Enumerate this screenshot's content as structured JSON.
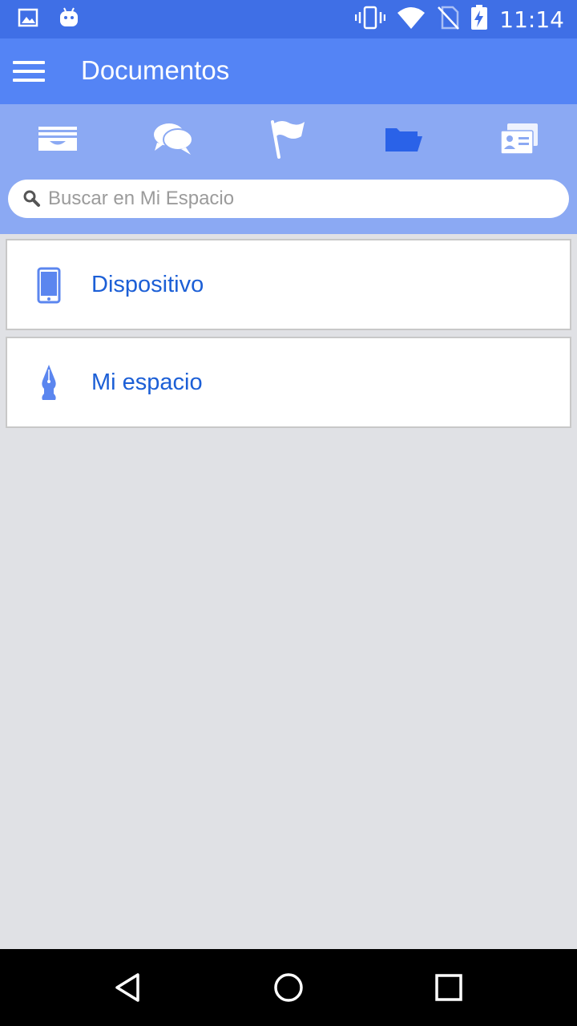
{
  "status_bar": {
    "time": "11:14",
    "icons": [
      "image-icon",
      "android-icon",
      "vibrate-icon",
      "wifi-icon",
      "no-sim-icon",
      "battery-charging-icon"
    ]
  },
  "app_bar": {
    "title": "Documentos",
    "menu_icon": "hamburger-menu-icon"
  },
  "tabs": [
    {
      "icon": "inbox-tray-icon",
      "selected": false
    },
    {
      "icon": "chat-bubbles-icon",
      "selected": false
    },
    {
      "icon": "flag-icon",
      "selected": false
    },
    {
      "icon": "folder-icon",
      "selected": true
    },
    {
      "icon": "contact-card-icon",
      "selected": false
    }
  ],
  "search": {
    "placeholder": "Buscar en Mi Espacio",
    "value": ""
  },
  "items": [
    {
      "label": "Dispositivo",
      "icon": "smartphone-icon"
    },
    {
      "label": "Mi espacio",
      "icon": "pen-nib-icon"
    }
  ],
  "colors": {
    "status_bar": "#3f6fe6",
    "app_bar": "#5484f5",
    "tab_strip": "#8ba9f3",
    "selected_tab": "#2a62e8",
    "item_text": "#1c5fd6",
    "background": "#e0e1e5"
  },
  "nav_bar": {
    "buttons": [
      "back-icon",
      "home-icon",
      "recents-icon"
    ]
  }
}
